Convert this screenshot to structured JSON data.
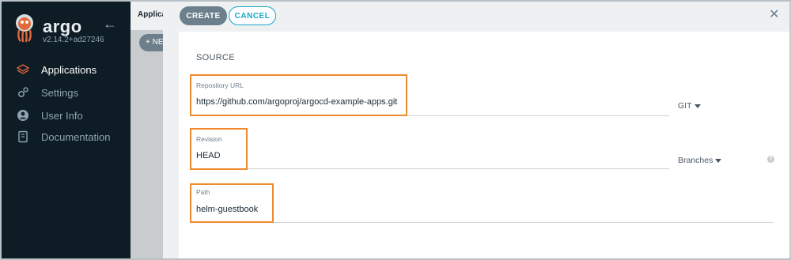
{
  "sidebar": {
    "brand": "argo",
    "version": "v2.14.2+ad27246",
    "items": [
      {
        "label": "Applications",
        "icon": "layers-icon",
        "active": true
      },
      {
        "label": "Settings",
        "icon": "gears-icon",
        "active": false
      },
      {
        "label": "User Info",
        "icon": "user-icon",
        "active": false
      },
      {
        "label": "Documentation",
        "icon": "book-icon",
        "active": false
      }
    ]
  },
  "background": {
    "breadcrumb": "Applications",
    "new_app_label": "+ NEW APP"
  },
  "panel": {
    "create_label": "CREATE",
    "cancel_label": "CANCEL",
    "section_title": "SOURCE",
    "repo": {
      "label": "Repository URL",
      "value": "https://github.com/argoproj/argocd-example-apps.git",
      "type": "GIT"
    },
    "revision": {
      "label": "Revision",
      "value": "HEAD",
      "type": "Branches"
    },
    "path": {
      "label": "Path",
      "value": "helm-guestbook"
    }
  },
  "colors": {
    "highlight": "#f08a2e",
    "accent": "#18a7c5",
    "sidebar_bg": "#0e1c25"
  }
}
